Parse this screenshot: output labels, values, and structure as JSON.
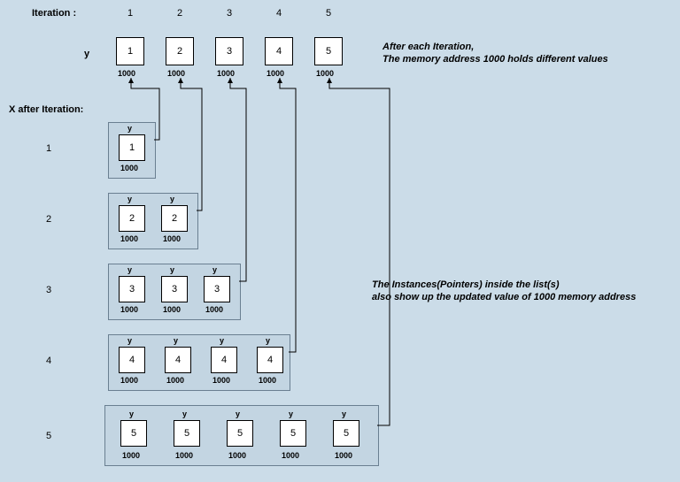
{
  "header": {
    "iteration_label": "Iteration :",
    "nums": [
      "1",
      "2",
      "3",
      "4",
      "5"
    ],
    "y_label": "y",
    "x_after_label": "X after Iteration:"
  },
  "y_boxes": [
    "1",
    "2",
    "3",
    "4",
    "5"
  ],
  "addr": "1000",
  "var_label": "y",
  "note_top_l1": "After each Iteration,",
  "note_top_l2": "The memory address 1000 holds different values",
  "note_mid_l1": "The Instances(Pointers) inside the list(s)",
  "note_mid_l2": " also show up the updated value of 1000 memory address",
  "rows": {
    "labels": [
      "1",
      "2",
      "3",
      "4",
      "5"
    ],
    "r1": [
      "1"
    ],
    "r2": [
      "2",
      "2"
    ],
    "r3": [
      "3",
      "3",
      "3"
    ],
    "r4": [
      "4",
      "4",
      "4",
      "4"
    ],
    "r5": [
      "5",
      "5",
      "5",
      "5",
      "5"
    ]
  }
}
